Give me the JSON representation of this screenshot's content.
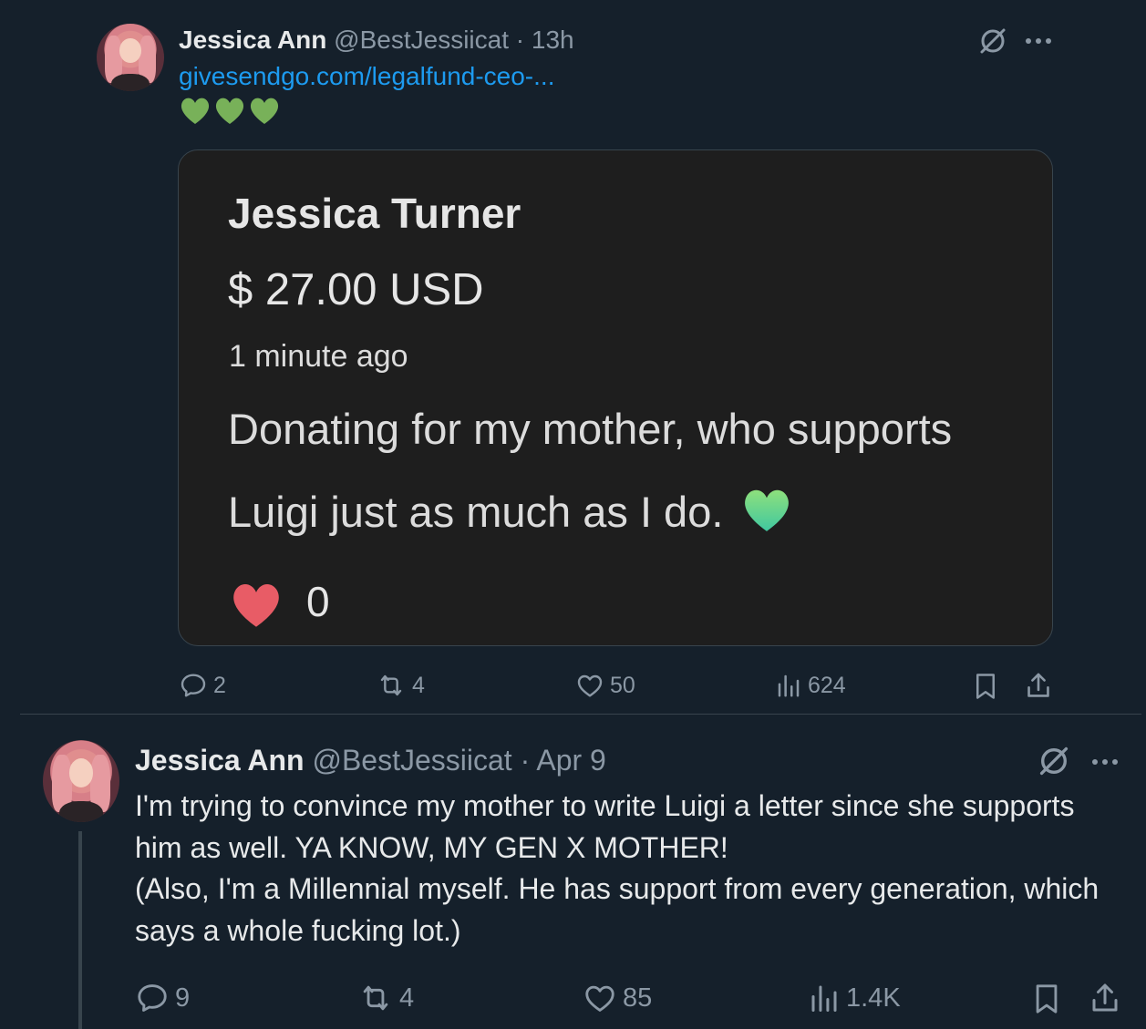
{
  "tweet1": {
    "author_name": "Jessica Ann",
    "author_handle": "@BestJessiicat",
    "separator": "·",
    "time": "13h",
    "link_text": "givesendgo.com/legalfund-ceo-...",
    "emojis": "💚💚💚",
    "card": {
      "donor_name": "Jessica Turner",
      "amount": "$ 27.00 USD",
      "time_ago": "1 minute ago",
      "message": "Donating for my mother, who supports Luigi just as much as I do.",
      "heart_emoji": "💚",
      "like_count": "0"
    },
    "actions": {
      "replies": "2",
      "reposts": "4",
      "likes": "50",
      "views": "624"
    }
  },
  "tweet2": {
    "author_name": "Jessica Ann",
    "author_handle": "@BestJessiicat",
    "separator": "·",
    "time": "Apr 9",
    "text_line1": "I'm trying to convince my mother to write Luigi a letter since she supports him as well. YA KNOW, MY GEN X MOTHER!",
    "text_line2": "(Also, I'm a Millennial myself. He has support from every generation, which says a whole fucking lot.)",
    "actions": {
      "replies": "9",
      "reposts": "4",
      "likes": "85",
      "views": "1.4K"
    }
  },
  "icons": {
    "grok": "grok-icon",
    "more": "more-icon",
    "reply": "reply-icon",
    "repost": "repost-icon",
    "like": "like-icon",
    "views": "views-icon",
    "bookmark": "bookmark-icon",
    "share": "share-icon"
  },
  "colors": {
    "background": "#15202b",
    "card_background": "#1e1e1e",
    "link": "#1d9bf0",
    "muted": "#8b98a5",
    "heart_red": "#e85c66",
    "heart_green": "#5fd38a"
  }
}
